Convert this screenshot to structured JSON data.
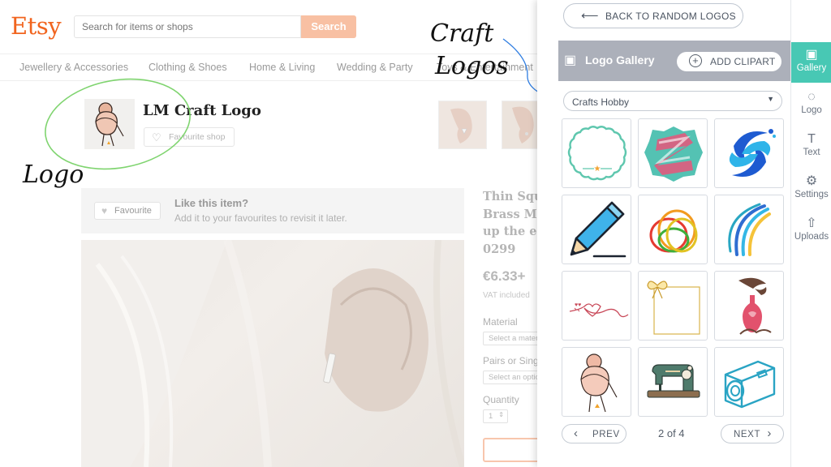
{
  "etsy": {
    "logo": "Etsy",
    "search_placeholder": "Search for items or shops",
    "search_button": "Search",
    "categories": [
      "Jewellery & Accessories",
      "Clothing & Shoes",
      "Home & Living",
      "Wedding & Party",
      "Toys & Entertainment"
    ],
    "shop_name": "LM Craft Logo",
    "favourite_shop": "Favourite shop",
    "favourite_button": "Favourite",
    "like_title": "Like this item?",
    "like_subtitle": "Add it to your favourites to revisit it later.",
    "product_title_lines": [
      "Thin Square",
      "Brass Mini",
      "up the ear",
      "0299"
    ],
    "price": "€6.33+",
    "vat": "VAT included",
    "material_label": "Material",
    "material_placeholder": "Select a material",
    "pairs_label": "Pairs or Single",
    "pairs_placeholder": "Select an option",
    "quantity_label": "Quantity",
    "quantity_value": "1"
  },
  "annotations": {
    "craft": "Craft",
    "logos": "Logos",
    "logo": "Logo",
    "arrow_color": "#2f7de1",
    "circle_color": "#7fd46f"
  },
  "editor": {
    "back_button": "BACK TO RANDOM LOGOS",
    "gallery_title": "Logo Gallery",
    "add_clipart": "ADD CLIPART",
    "category": "Crafts Hobby",
    "prev": "PREV",
    "next": "NEXT",
    "page_indicator": "2 of 4",
    "tiles": [
      "scalloped-badge-icon",
      "teal-z-badge-icon",
      "blue-swirl-icon",
      "pencil-icon",
      "rainbow-rings-icon",
      "color-arc-icon",
      "heart-script-icon",
      "bow-frame-icon",
      "perfume-bottle-icon",
      "bun-girl-icon",
      "sewing-machine-icon",
      "camera-icon"
    ],
    "nav": [
      {
        "label": "Gallery",
        "icon": "gallery-icon",
        "active": true
      },
      {
        "label": "Logo",
        "icon": "drop-icon",
        "active": false
      },
      {
        "label": "Text",
        "icon": "text-icon",
        "active": false
      },
      {
        "label": "Settings",
        "icon": "sliders-icon",
        "active": false
      },
      {
        "label": "Uploads",
        "icon": "upload-icon",
        "active": false
      }
    ],
    "accent": "#48c8b4"
  }
}
